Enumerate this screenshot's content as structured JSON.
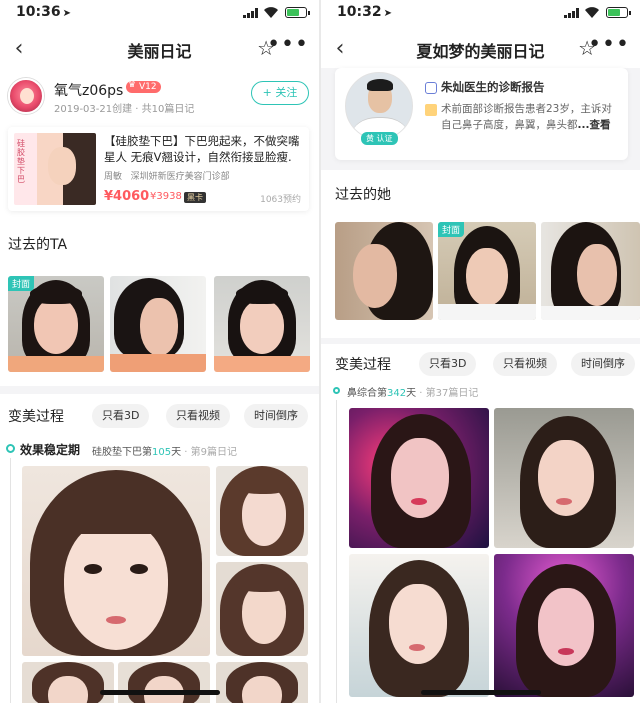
{
  "left": {
    "status_time": "10:36",
    "nav_title": "美丽日记",
    "user": {
      "name": "氧气z06ps",
      "vip": "V12",
      "meta": "2019-03-21创建 · 共10篇日记",
      "follow_label": "+ 关注"
    },
    "product": {
      "thumb_text": "硅胶垫下巴",
      "title": "【硅胶垫下巴】下巴兜起来，不做突嘴星人 无痕V翘设计，自然衔接显脸瘦.",
      "doctor": "周敏",
      "hospital": "深圳妍新医疗美容门诊部",
      "price": "¥4060",
      "price_member": "¥3938",
      "card_badge": "黑卡",
      "count": "1063预约"
    },
    "past_title": "过去的TA",
    "cover_tag": "封面",
    "process_title": "变美过程",
    "filters": [
      "只看3D",
      "只看视频",
      "时间倒序"
    ],
    "timeline": {
      "stage": "效果稳定期",
      "meta_prefix": "硅胶垫下巴第",
      "day": "105",
      "meta_mid": "天",
      "sep": " · ",
      "entry": "第9篇日记"
    }
  },
  "right": {
    "status_time": "10:32",
    "nav_title": "夏如梦的美丽日记",
    "doctor": {
      "verified": "黄 认证",
      "report_title": "朱灿医生的诊断报告",
      "report_text": "术前面部诊断报告患者23岁，主诉对自己鼻子高度，鼻翼，鼻头都",
      "more": "...查看"
    },
    "past_title": "过去的她",
    "cover_tag": "封面",
    "process_title": "变美过程",
    "filters": [
      "只看3D",
      "只看视频",
      "时间倒序"
    ],
    "timeline": {
      "meta_prefix": "鼻综合第",
      "day": "342",
      "meta_mid": "天",
      "sep": " · ",
      "entry": "第37篇日记"
    }
  },
  "colors": {
    "accent": "#2ec4b6",
    "price": "#ff5a5f",
    "vip": "#ff6b6b"
  }
}
